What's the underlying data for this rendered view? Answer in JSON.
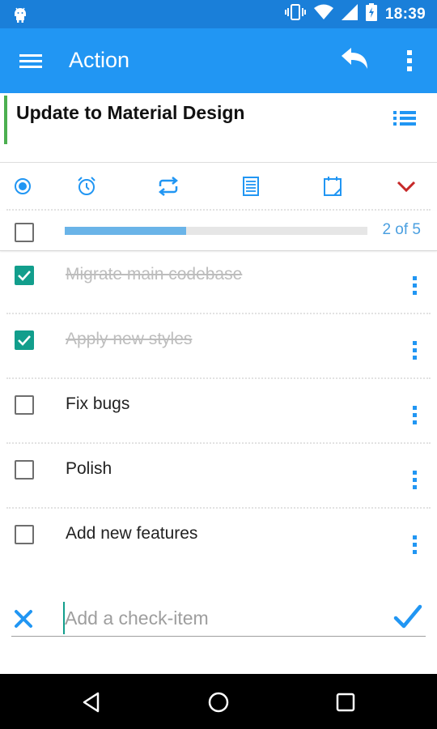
{
  "status_bar": {
    "time": "18:39",
    "icons": [
      "android-icon",
      "vibrate-icon",
      "wifi-icon",
      "signal-icon",
      "battery-charging-icon"
    ]
  },
  "app_bar": {
    "title": "Action",
    "icons": [
      "menu-icon",
      "undo-icon",
      "more-vert-icon"
    ]
  },
  "task": {
    "title": "Update to Material Design",
    "accent_color": "#4caf50"
  },
  "toolbar": {
    "icons": [
      "radio-icon",
      "alarm-icon",
      "repeat-icon",
      "note-icon",
      "calendar-icon",
      "chevron-down-icon"
    ],
    "accent_color": "#2196f3",
    "chevron_color": "#c62828"
  },
  "progress": {
    "completed": 2,
    "total": 5,
    "fraction": 0.4,
    "label": "2 of 5"
  },
  "checklist": [
    {
      "label": "Migrate main codebase",
      "checked": true
    },
    {
      "label": "Apply new styles",
      "checked": true
    },
    {
      "label": "Fix bugs",
      "checked": false
    },
    {
      "label": "Polish",
      "checked": false
    },
    {
      "label": "Add new features",
      "checked": false
    }
  ],
  "add_item": {
    "placeholder": "Add a check-item",
    "value": ""
  },
  "colors": {
    "primary": "#2196f3",
    "status_bar": "#1a7fd9",
    "checkbox_checked": "#129e8c"
  }
}
